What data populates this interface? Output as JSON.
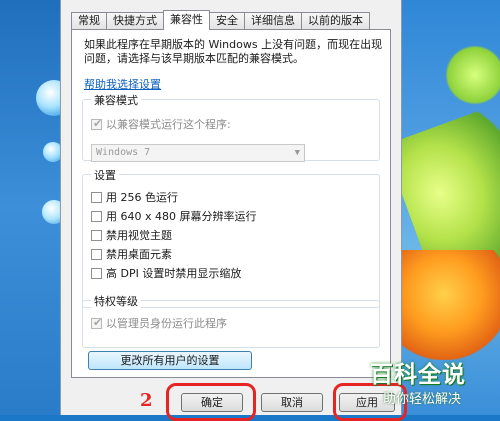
{
  "tabs": [
    "常规",
    "快捷方式",
    "兼容性",
    "安全",
    "详细信息",
    "以前的版本"
  ],
  "active_tab_index": 2,
  "intro_text": "如果此程序在早期版本的 Windows 上没有问题，而现在出现问题，请选择与该早期版本匹配的兼容模式。",
  "help_link": "帮助我选择设置",
  "compat_mode": {
    "title": "兼容模式",
    "checkbox_label": "以兼容模式运行这个程序:",
    "checked": true,
    "selected_os": "Windows 7"
  },
  "settings": {
    "title": "设置",
    "items": [
      {
        "label": "用 256 色运行",
        "checked": false
      },
      {
        "label": "用 640 x 480 屏幕分辨率运行",
        "checked": false
      },
      {
        "label": "禁用视觉主题",
        "checked": false
      },
      {
        "label": "禁用桌面元素",
        "checked": false
      },
      {
        "label": "高 DPI 设置时禁用显示缩放",
        "checked": false
      }
    ]
  },
  "privilege": {
    "title": "特权等级",
    "checkbox_label": "以管理员身份运行此程序",
    "checked": true
  },
  "all_users_button": "更改所有用户的设置",
  "footer": {
    "ok": "确定",
    "cancel": "取消",
    "apply": "应用"
  },
  "annotation_number": "2",
  "watermark": {
    "main": "百科全说",
    "sub": "助你轻松解决"
  },
  "colors": {
    "link": "#0b5fbf",
    "annotation": "#e62424"
  }
}
